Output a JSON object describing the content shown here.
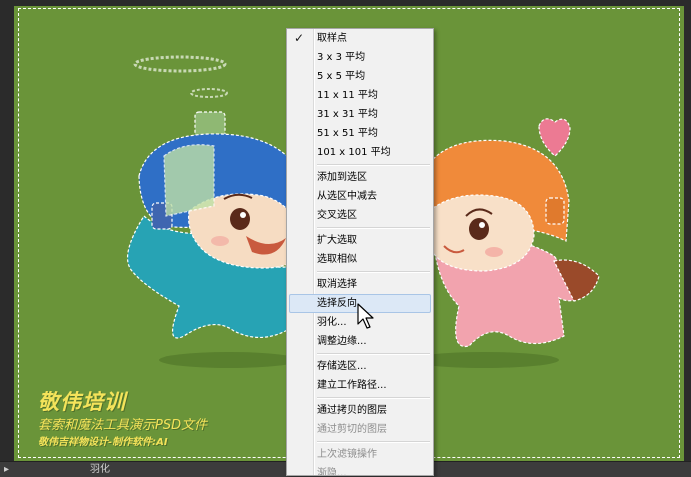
{
  "watermark": {
    "title": "敬伟培训",
    "line1": "套索和魔法工具演示PSD文件",
    "line2": "敬伟吉祥物设计-制作软件:AI"
  },
  "status_bar": {
    "text": "羽化"
  },
  "context_menu": {
    "groups": [
      [
        {
          "label": "取样点",
          "checked": true
        },
        {
          "label": "3 x 3 平均"
        },
        {
          "label": "5 x 5 平均"
        },
        {
          "label": "11 x 11 平均"
        },
        {
          "label": "31 x 31 平均"
        },
        {
          "label": "51 x 51 平均"
        },
        {
          "label": "101 x 101 平均"
        }
      ],
      [
        {
          "label": "添加到选区"
        },
        {
          "label": "从选区中减去"
        },
        {
          "label": "交叉选区"
        }
      ],
      [
        {
          "label": "扩大选取"
        },
        {
          "label": "选取相似"
        }
      ],
      [
        {
          "label": "取消选择"
        },
        {
          "label": "选择反向",
          "hover": true
        },
        {
          "label": "羽化..."
        },
        {
          "label": "调整边缘..."
        }
      ],
      [
        {
          "label": "存储选区..."
        },
        {
          "label": "建立工作路径..."
        }
      ],
      [
        {
          "label": "通过拷贝的图层"
        },
        {
          "label": "通过剪切的图层",
          "disabled": true
        }
      ],
      [
        {
          "label": "上次滤镜操作",
          "disabled": true
        },
        {
          "label": "渐隐...",
          "disabled": true
        }
      ]
    ]
  },
  "colors": {
    "canvas_background": "#6a9439",
    "watermark_text": "#f4e35a",
    "menu_hover": "#dce8f6"
  }
}
